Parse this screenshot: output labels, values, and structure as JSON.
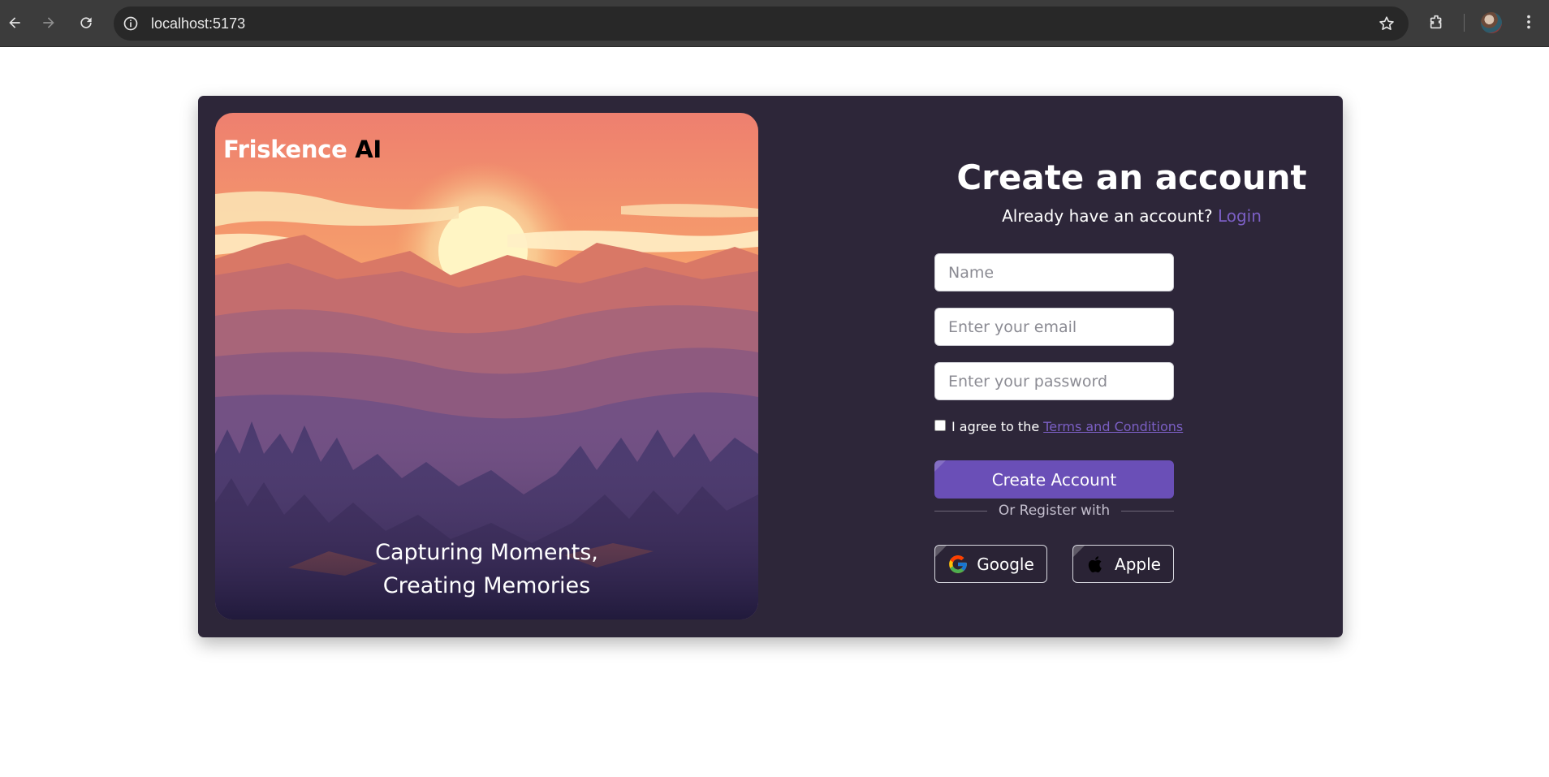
{
  "browser": {
    "url": "localhost:5173",
    "icons": [
      "back-arrow-icon",
      "forward-arrow-icon",
      "reload-icon",
      "site-info-icon",
      "bookmark-star-icon",
      "extensions-icon",
      "profile-avatar",
      "more-menu-icon"
    ]
  },
  "hero": {
    "brand_primary": "Friskence",
    "brand_secondary": "AI",
    "tagline_line1": "Capturing Moments,",
    "tagline_line2": "Creating Memories"
  },
  "form": {
    "heading": "Create an account",
    "already_text": "Already have an account?",
    "login_link": "Login",
    "name_placeholder": "Name",
    "email_placeholder": "Enter your email",
    "password_placeholder": "Enter your password",
    "agree_text": "I agree to the",
    "terms_link": "Terms and Conditions",
    "create_button": "Create Account",
    "divider_text": "Or Register with",
    "google_button": "Google",
    "apple_button": "Apple"
  },
  "colors": {
    "card_bg": "#2d2639",
    "accent": "#6a4fb7",
    "link": "#7b5fc4"
  }
}
